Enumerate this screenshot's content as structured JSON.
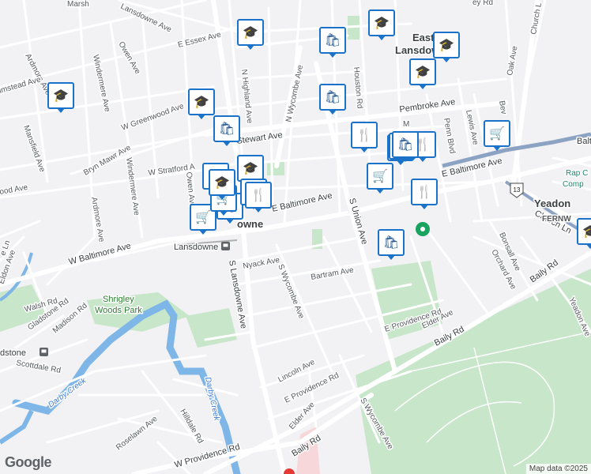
{
  "places": {
    "lansdowne_top": "Lansdowne",
    "east_lansdowne_1": "East",
    "east_lansdowne_2": "Lansdowne",
    "lansdowne_center": "owne",
    "yeadon": "Yeadon",
    "fernwood": "FERNW",
    "rap_1": "Rap C",
    "rap_2": "Comp",
    "station_lansdowne": "Lansdowne",
    "station_lansdowne_icon": "train-station-icon",
    "station_dstone": "dstone"
  },
  "parks": {
    "shrigley_1": "Shrigley",
    "shrigley_2": "Woods Park"
  },
  "waterways": {
    "darby_1": "Darby Creek",
    "darby_2": "Darby Creek"
  },
  "streets": {
    "marsh": "Marsh",
    "lansdowne_ave_n": "Lansdowne Ave",
    "e_essex": "E Essex Ave",
    "owen_ave_n": "Owen Ave",
    "ardmore_n": "Ardmore Ave",
    "windermere_n": "Windermere Ave",
    "n_highland": "N Highland Ave",
    "n_wycombe": "N Wycombe Ave",
    "houston": "Houston Rd",
    "pembroke": "Pembroke Ave",
    "w_greenwood": "W Greenwood Ave",
    "stewart": "Stewart Ave",
    "bryn_mawr": "Bryn Mawr Ave",
    "mansfield": "Mansfield Ave",
    "lmstead": "lmstead Ave",
    "w_stratford": "W Stratford A",
    "owen_ave_s": "Owen Ave",
    "ood_ave": "ood Ave",
    "ardmore_s": "Ardmore Ave",
    "windermere_s": "Windermere Ave",
    "e_baltimore_1": "E Baltimore Ave",
    "e_baltimore_2": "E Baltimore Ave",
    "w_baltimore": "W Baltimore Ave",
    "s_union": "S Union Ave",
    "s_lansdowne": "S Lansdowne Ave",
    "nyack": "Nyack Ave",
    "s_wycombe": "S Wycombe Ave",
    "bartram": "Bartram Ave",
    "eldon": "Eldon Ave",
    "walsh": "Walsh Rd",
    "gladstone": "Gladstone Rd",
    "madison": "Madison Rd",
    "e_ln": "e Ln",
    "scottdale": "Scottdale Rd",
    "e_providence_1": "E Providence Rd",
    "e_providence_2": "E Providence Rd",
    "elder_1": "Elder Ave",
    "elder_2": "Elder Ave",
    "lincoln": "Lincoln Ave",
    "baily_1": "Baily Rd",
    "baily_2": "Baily Rd",
    "baily_3": "Baily Rd",
    "hilldale": "Hilldale Rd",
    "roselawn": "Roselawn Ave",
    "w_providence": "W Providence Rd",
    "s_wycombe_s": "S Wycombe Ave",
    "oak": "Oak Ave",
    "church_ln_top": "Church L",
    "church_ln": "Church Ln",
    "bonsall": "Bonsall Ave",
    "orchard": "Orchard Ave",
    "yeadon_ave": "Yeadon Ave",
    "lewis": "Lewis Ave",
    "penn": "Penn Blvd",
    "bev": "Bev",
    "ey_rd": "ey Rd",
    "me": "M",
    "balt_right": "Balt",
    "hwy13": "13"
  },
  "markers": [
    {
      "type": "school",
      "icon": "mortarboard-icon",
      "glyph": "🎓"
    },
    {
      "type": "school",
      "icon": "mortarboard-icon",
      "glyph": "🎓"
    },
    {
      "type": "school",
      "icon": "mortarboard-icon",
      "glyph": "🎓"
    },
    {
      "type": "school",
      "icon": "mortarboard-icon",
      "glyph": "🎓"
    },
    {
      "type": "school",
      "icon": "mortarboard-icon",
      "glyph": "🎓"
    },
    {
      "type": "school",
      "icon": "mortarboard-icon",
      "glyph": "🎓"
    },
    {
      "type": "school",
      "icon": "mortarboard-icon",
      "glyph": "🎓"
    },
    {
      "type": "school",
      "icon": "mortarboard-icon",
      "glyph": "🎓"
    },
    {
      "type": "shopping",
      "icon": "shopping-bag-icon",
      "glyph": "🛍"
    },
    {
      "type": "shopping",
      "icon": "shopping-bag-icon",
      "glyph": "🛍"
    },
    {
      "type": "shopping",
      "icon": "shopping-bag-icon",
      "glyph": "🛍"
    },
    {
      "type": "shopping",
      "icon": "shopping-bag-icon",
      "glyph": "🛍"
    },
    {
      "type": "shopping",
      "icon": "shopping-bag-icon",
      "glyph": "🛍"
    },
    {
      "type": "shopping",
      "icon": "shopping-bag-icon",
      "glyph": "🛍"
    },
    {
      "type": "restaurant",
      "icon": "fork-knife-icon",
      "glyph": "🍴"
    },
    {
      "type": "restaurant",
      "icon": "fork-knife-icon",
      "glyph": "🍴"
    },
    {
      "type": "restaurant",
      "icon": "fork-knife-icon",
      "glyph": "🍴"
    },
    {
      "type": "restaurant",
      "icon": "fork-knife-icon",
      "glyph": "🍴"
    },
    {
      "type": "grocery",
      "icon": "shopping-cart-icon",
      "glyph": "🛒"
    },
    {
      "type": "grocery",
      "icon": "shopping-cart-icon",
      "glyph": "🛒"
    },
    {
      "type": "grocery",
      "icon": "shopping-cart-icon",
      "glyph": "🛒"
    },
    {
      "type": "grocery",
      "icon": "shopping-cart-icon",
      "glyph": "🛒"
    },
    {
      "type": "cluster",
      "icon": "stacked-markers-icon",
      "glyph": "▦"
    },
    {
      "type": "cluster",
      "icon": "stacked-markers-icon",
      "glyph": "▦"
    },
    {
      "type": "school",
      "icon": "mortarboard-icon",
      "glyph": "🎓"
    },
    {
      "type": "restaurant",
      "icon": "fork-knife-icon",
      "glyph": "🍴"
    },
    {
      "type": "shopping",
      "icon": "shopping-bag-icon",
      "glyph": "🛍"
    }
  ],
  "colors": {
    "road": "#ffffff",
    "major_road": "#ffffff",
    "highway": "#8da3c4",
    "park": "#c8e6c9",
    "water": "#7fb6e8",
    "marker_border": "#1a73c9",
    "background": "#f2f2f4"
  },
  "branding": {
    "logo": "Google"
  },
  "attribution": "Map data ©2025"
}
